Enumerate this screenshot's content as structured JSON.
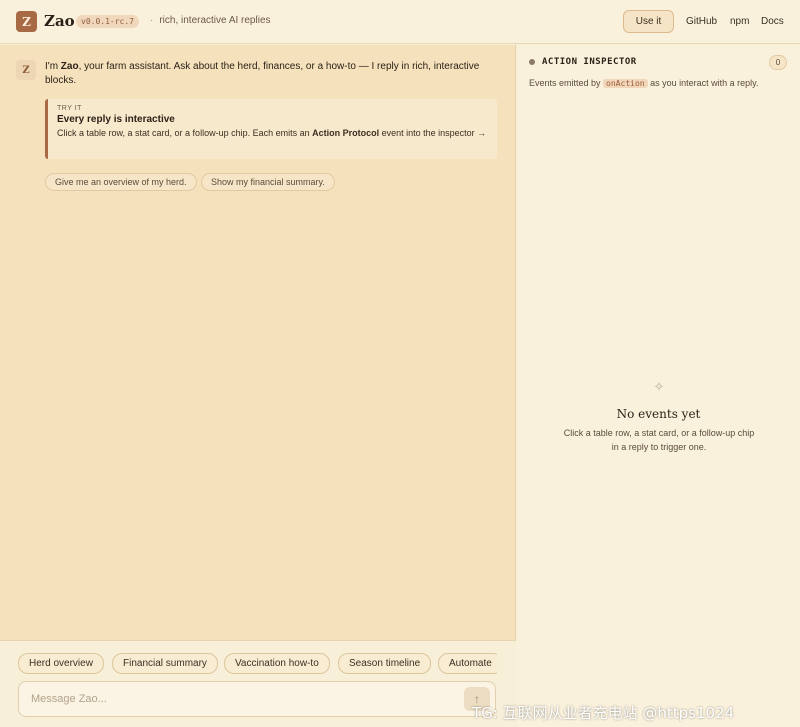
{
  "header": {
    "logo_letter": "Z",
    "app_name": "Zao",
    "version": "v0.0.1-rc.7",
    "separator": "·",
    "tagline": "rich, interactive AI replies",
    "use_it": "Use it",
    "links": [
      "GitHub",
      "npm",
      "Docs"
    ]
  },
  "chat": {
    "avatar_letter": "Z",
    "intro_pre": "I'm ",
    "intro_name": "Zao",
    "intro_post": ", your farm assistant. Ask about the herd, finances, or a how-to — I reply in rich, interactive blocks.",
    "tryit": {
      "kicker": "TRY IT",
      "title": "Every reply is interactive",
      "body_pre": "Click a table row, a stat card, or a follow-up chip. Each emits an ",
      "body_bold": "Action Protocol",
      "body_post": " event into the inspector →"
    },
    "followups": [
      "Give me an overview of my herd.",
      "Show my financial summary."
    ]
  },
  "composer": {
    "quick_chips": [
      "Herd overview",
      "Financial summary",
      "Vaccination how-to",
      "Season timeline",
      "Automate"
    ],
    "placeholder": "Message Zao...",
    "send_icon": "arrow-up-icon"
  },
  "inspector": {
    "title": "ACTION INSPECTOR",
    "count": "0",
    "desc_pre": "Events emitted by ",
    "desc_code": "onAction",
    "desc_post": " as you interact with a reply.",
    "empty_title": "No events yet",
    "empty_desc": "Click a table row, a stat card, or a follow-up chip in a reply to trigger one."
  },
  "watermark": "TG: 互联网从业者充电站 @https1024",
  "colors": {
    "accent": "#a86a45",
    "chat_bg": "#f5e2bc",
    "panel_bg": "#faf1dc"
  }
}
